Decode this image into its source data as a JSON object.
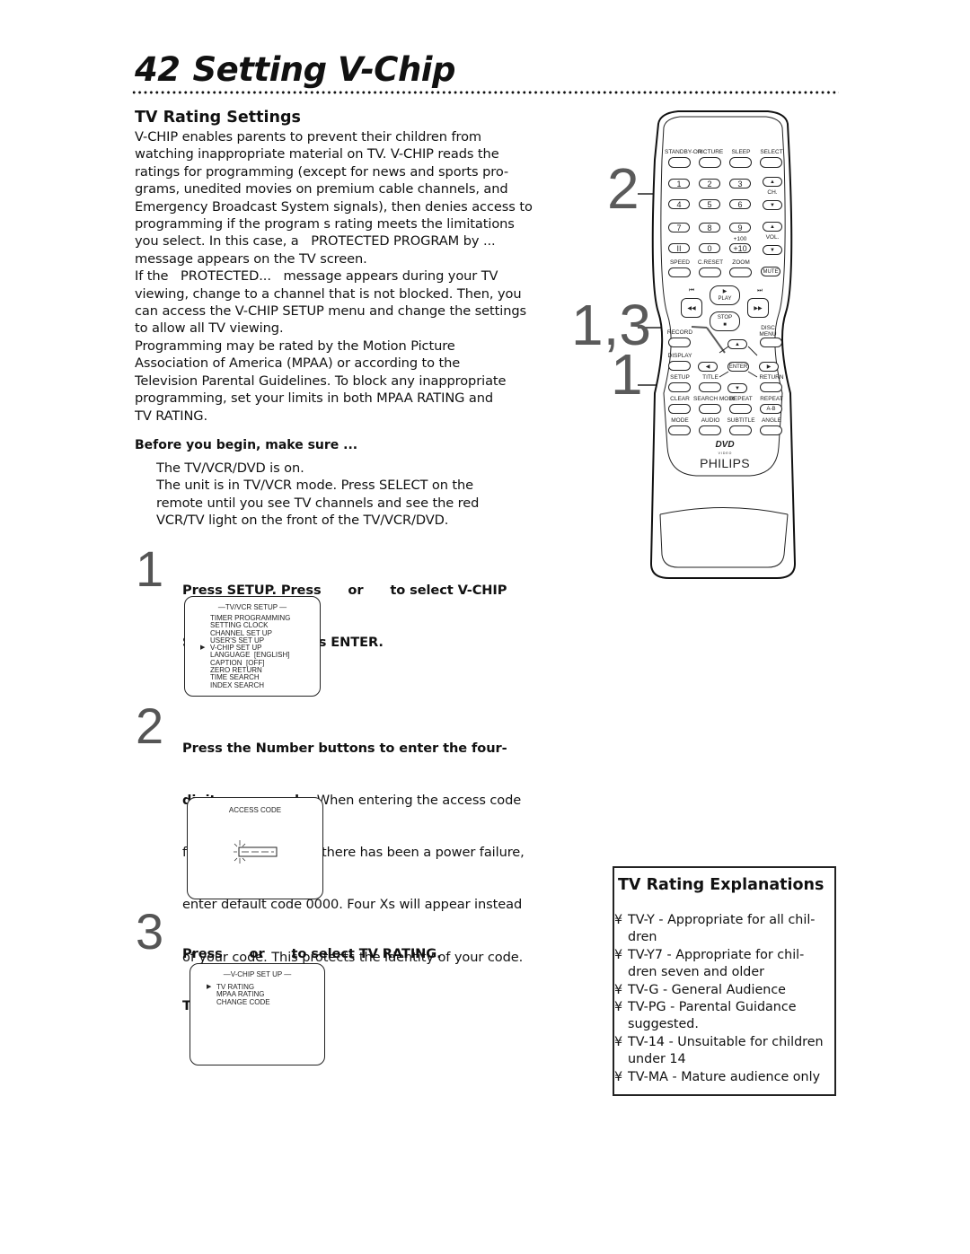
{
  "header": {
    "page_number": "42",
    "title": "Setting V-Chip"
  },
  "section": {
    "heading": "TV Rating Settings",
    "intro_lines": [
      "V-CHIP enables parents to prevent their children from",
      "watching inappropriate material on TV. V-CHIP reads the",
      "ratings for programming (except for news and sports pro-",
      "grams, unedited movies on premium cable channels, and",
      "Emergency Broadcast System signals), then denies access to",
      "programming if the program s rating meets the limitations",
      "you select. In this case, a   PROTECTED PROGRAM by ...",
      "message appears on the TV screen.",
      "If the   PROTECTED...   message appears during your TV",
      "viewing, change to a channel that is not blocked. Then, you",
      "can access the V-CHIP SETUP menu and change the settings",
      "to allow all TV viewing.",
      "Programming may be rated by the Motion Picture",
      "Association of America (MPAA) or according to the",
      "Television Parental Guidelines. To block any inappropriate",
      "programming, set your limits in both MPAA RATING and",
      "TV RATING."
    ]
  },
  "before_begin": {
    "heading": "Before you begin, make sure ...",
    "lines": [
      "The TV/VCR/DVD is on.",
      "The unit is in TV/VCR mode. Press SELECT on the",
      "remote until you see TV channels and see the red",
      "VCR/TV light on the front of the TV/VCR/DVD."
    ]
  },
  "steps": [
    {
      "number": "1",
      "bold_lines": [
        "Press SETUP. Press      or      to select V-CHIP",
        "SET UP. Then, press ENTER."
      ],
      "screen": {
        "title": "—TV/VCR SETUP —",
        "items": [
          "TIMER PROGRAMMING",
          "SETTING CLOCK",
          "CHANNEL SET UP",
          "USER'S SET UP",
          "V-CHIP SET UP",
          "LANGUAGE  [ENGLISH]",
          "CAPTION  [OFF]",
          "ZERO RETURN",
          "TIME SEARCH",
          "INDEX SEARCH"
        ],
        "selected_index": 4
      }
    },
    {
      "number": "2",
      "bold_line_1": "Press the Number buttons to enter the four-",
      "bold_line_2": "digit access code.",
      "rest_line_2": " When entering the access code",
      "lines": [
        "for the first time or if there has been a power failure,",
        "enter default code 0000. Four Xs will appear instead",
        "of your code. This protects the identity of your code."
      ],
      "screen": {
        "title": "ACCESS CODE"
      }
    },
    {
      "number": "3",
      "bold_lines": [
        "Press      or      to select TV RATING.",
        "Then, press ENTER."
      ],
      "screen": {
        "title": "—V-CHIP SET UP —",
        "items": [
          "TV RATING",
          "MPAA RATING",
          "CHANGE CODE"
        ],
        "selected_index": 0
      }
    }
  ],
  "explanations": {
    "heading": "TV Rating Explanations",
    "bullet": "¥",
    "items": [
      {
        "lines": [
          "TV-Y - Appropriate for all chil-",
          "dren"
        ]
      },
      {
        "lines": [
          "TV-Y7 - Appropriate for chil-",
          "dren seven and older"
        ]
      },
      {
        "lines": [
          "TV-G - General Audience"
        ]
      },
      {
        "lines": [
          "TV-PG - Parental Guidance",
          "suggested."
        ]
      },
      {
        "lines": [
          "TV-14 - Unsuitable for children",
          "under 14"
        ]
      },
      {
        "lines": [
          "TV-MA - Mature audience only"
        ]
      }
    ]
  },
  "remote": {
    "callouts": [
      "2",
      "1,3",
      "1"
    ],
    "top_labels": [
      "STANDBY-ON",
      "PICTURE",
      "SLEEP",
      "SELECT"
    ],
    "digits": [
      "1",
      "2",
      "3",
      "4",
      "5",
      "6",
      "7",
      "8",
      "9",
      "II",
      "0",
      "+10"
    ],
    "plus100": "+100",
    "ch_label": "CH.",
    "vol_label": "VOL.",
    "row_labels_1": [
      "SPEED",
      "C.RESET",
      "ZOOM"
    ],
    "mute": "MUTE",
    "play": "PLAY",
    "stop": "STOP",
    "record": "RECORD",
    "disc_menu_1": "DISC",
    "disc_menu_2": "MENU",
    "display": "DISPLAY",
    "enter": "ENTER",
    "row_labels_2": [
      "SETUP",
      "TITLE",
      "RETURN"
    ],
    "row_labels_3": [
      "CLEAR",
      "SEARCH MODE",
      "REPEAT",
      "REPEAT"
    ],
    "ab": "A-B",
    "row_labels_4": [
      "MODE",
      "AUDIO",
      "SUBTITLE",
      "ANGLE"
    ],
    "dvd_logo": "DVD",
    "dvd_video": "V I D E O",
    "brand": "PHILIPS"
  }
}
